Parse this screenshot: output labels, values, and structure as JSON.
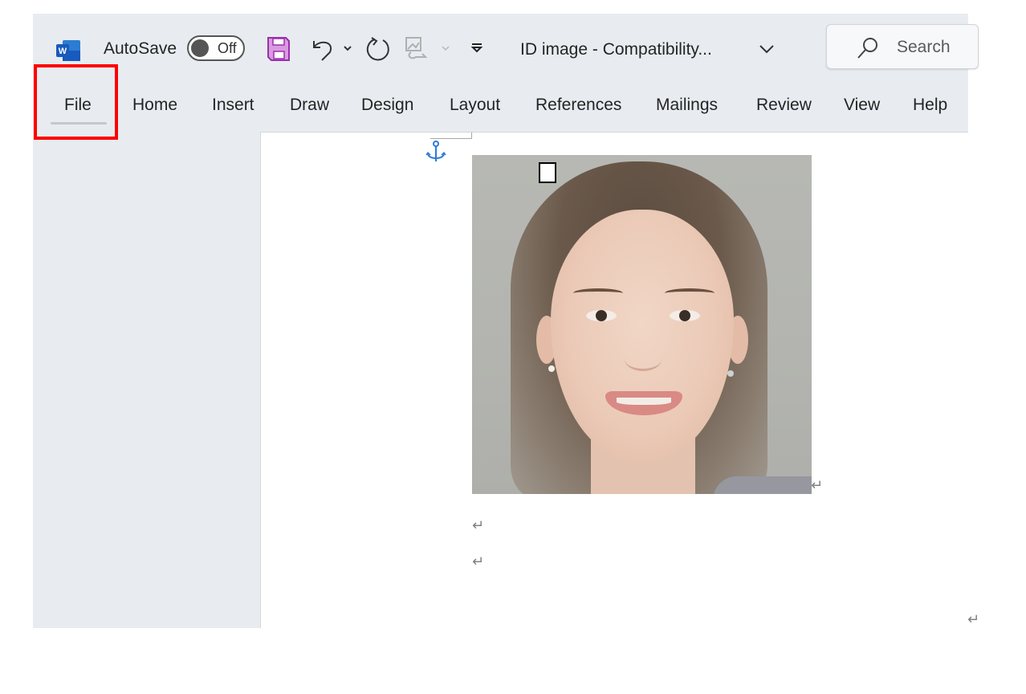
{
  "titlebar": {
    "app_icon": "word-logo-icon",
    "autosave_label": "AutoSave",
    "autosave_state": "Off",
    "quick_access": [
      {
        "name": "save-icon",
        "color": "#b146c2"
      },
      {
        "name": "undo-icon"
      },
      {
        "name": "undo-dropdown-icon"
      },
      {
        "name": "redo-icon"
      },
      {
        "name": "picture-switch-icon",
        "disabled": true
      },
      {
        "name": "picture-switch-dropdown-icon",
        "disabled": true
      },
      {
        "name": "customize-toolbar-icon"
      }
    ],
    "document_title": "ID image  -  Compatibility...",
    "search_placeholder": "Search"
  },
  "ribbon": {
    "tabs": [
      {
        "label": "File",
        "highlighted": true
      },
      {
        "label": "Home"
      },
      {
        "label": "Insert"
      },
      {
        "label": "Draw"
      },
      {
        "label": "Design"
      },
      {
        "label": "Layout"
      },
      {
        "label": "References"
      },
      {
        "label": "Mailings"
      },
      {
        "label": "Review"
      },
      {
        "label": "View"
      },
      {
        "label": "Help"
      }
    ]
  },
  "document": {
    "image_description": "Portrait photo of a smiling woman with long brown hair on a gray background",
    "paragraph_mark": "↵",
    "anchor_color": "#2b7cd3"
  },
  "annotation": {
    "highlight_target": "File",
    "highlight_color": "#ff0000"
  }
}
